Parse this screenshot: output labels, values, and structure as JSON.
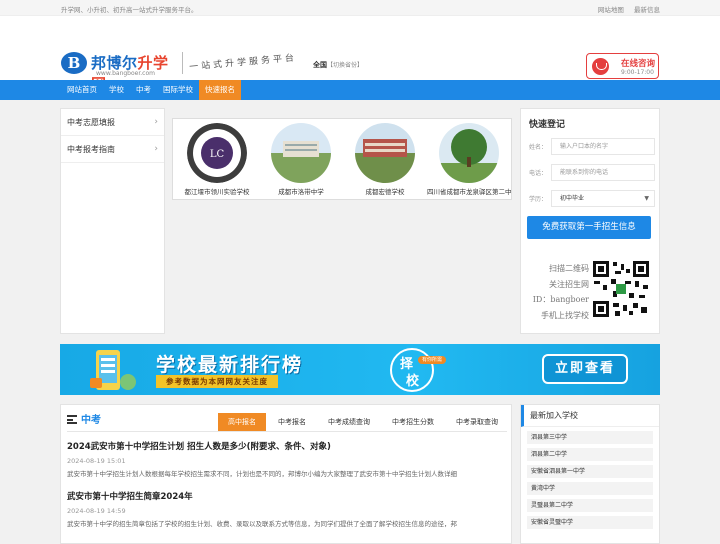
{
  "topbar": {
    "slogan": "升学网、小升初、初升高一站式升学服务平台。",
    "links": [
      "网站地图",
      "最新信息"
    ]
  },
  "header": {
    "logo_letter": "B",
    "brand_a": "邦博尔",
    "brand_b": "升学网",
    "domain": "www.bangboer.com",
    "tagline": "一站式升学服务平台",
    "region": "全国",
    "region_switch": "【切换省份】",
    "consult_title": "在线咨询",
    "consult_hours": "9:00-17:00"
  },
  "nav": {
    "items": [
      "网站首页",
      "学校",
      "中考",
      "国际学校",
      "快速报名"
    ],
    "active_index": 4
  },
  "leftmenu": {
    "items": [
      "中考志愿填报",
      "中考报考指南"
    ]
  },
  "schools": [
    {
      "name": "都江堰市领川实验学校",
      "logo_text": "LC"
    },
    {
      "name": "成都市洛带中学"
    },
    {
      "name": "成都宏德学校"
    },
    {
      "name": "四川省成都市龙泉驿区第二中学"
    }
  ],
  "register": {
    "title": "快速登记",
    "name_label": "姓名：",
    "name_placeholder": "输入户口本的名字",
    "phone_label": "电话：",
    "phone_placeholder": "能联系到你的电话",
    "grade_label": "学历：",
    "grade_value": "初中毕业",
    "submit": "免费获取第一手招生信息",
    "qr_lines": [
      "扫描二维码",
      "关注招生网",
      "ID：bangboer",
      "手机上找学校"
    ]
  },
  "banner": {
    "headline": "学校最新排行榜",
    "sub": "参考数据为本网网友关注度",
    "badge_char_1": "择",
    "badge_char_2": "校",
    "badge_pill": "有你所需",
    "cta": "立即查看"
  },
  "news": {
    "section_title": "中考",
    "tabs": [
      "高中报名",
      "中考报名",
      "中考成绩查询",
      "中考招生分数",
      "中考录取查询"
    ],
    "active_tab": 0,
    "articles": [
      {
        "title": "2024武安市第十中学招生计划 招生人数是多少(附要求、条件、对象)",
        "date": "2024-08-19 15:01",
        "summary": "武安市第十中学招生计划人数根据每年学校招生需求不同，计划也是不同的，邦博尔小编为大家整理了武安市第十中学招生计划人数详细"
      },
      {
        "title": "武安市第十中学招生简章2024年",
        "date": "2024-08-19 14:59",
        "summary": "武安市第十中学的招生简章包括了学校的招生计划、收费、录取以及联系方式等信息，为同学们提供了全面了解学校招生信息的途径，邦"
      }
    ]
  },
  "newest": {
    "title": "最新加入学校",
    "items": [
      "泗县第三中学",
      "泗县第二中学",
      "安徽省泗县第一中学",
      "黄湾中学",
      "灵璧县第二中学",
      "安徽省灵璧中学"
    ]
  },
  "colors": {
    "primary": "#1e88e5",
    "accent": "#f08a24",
    "alert": "#e43f3f"
  }
}
